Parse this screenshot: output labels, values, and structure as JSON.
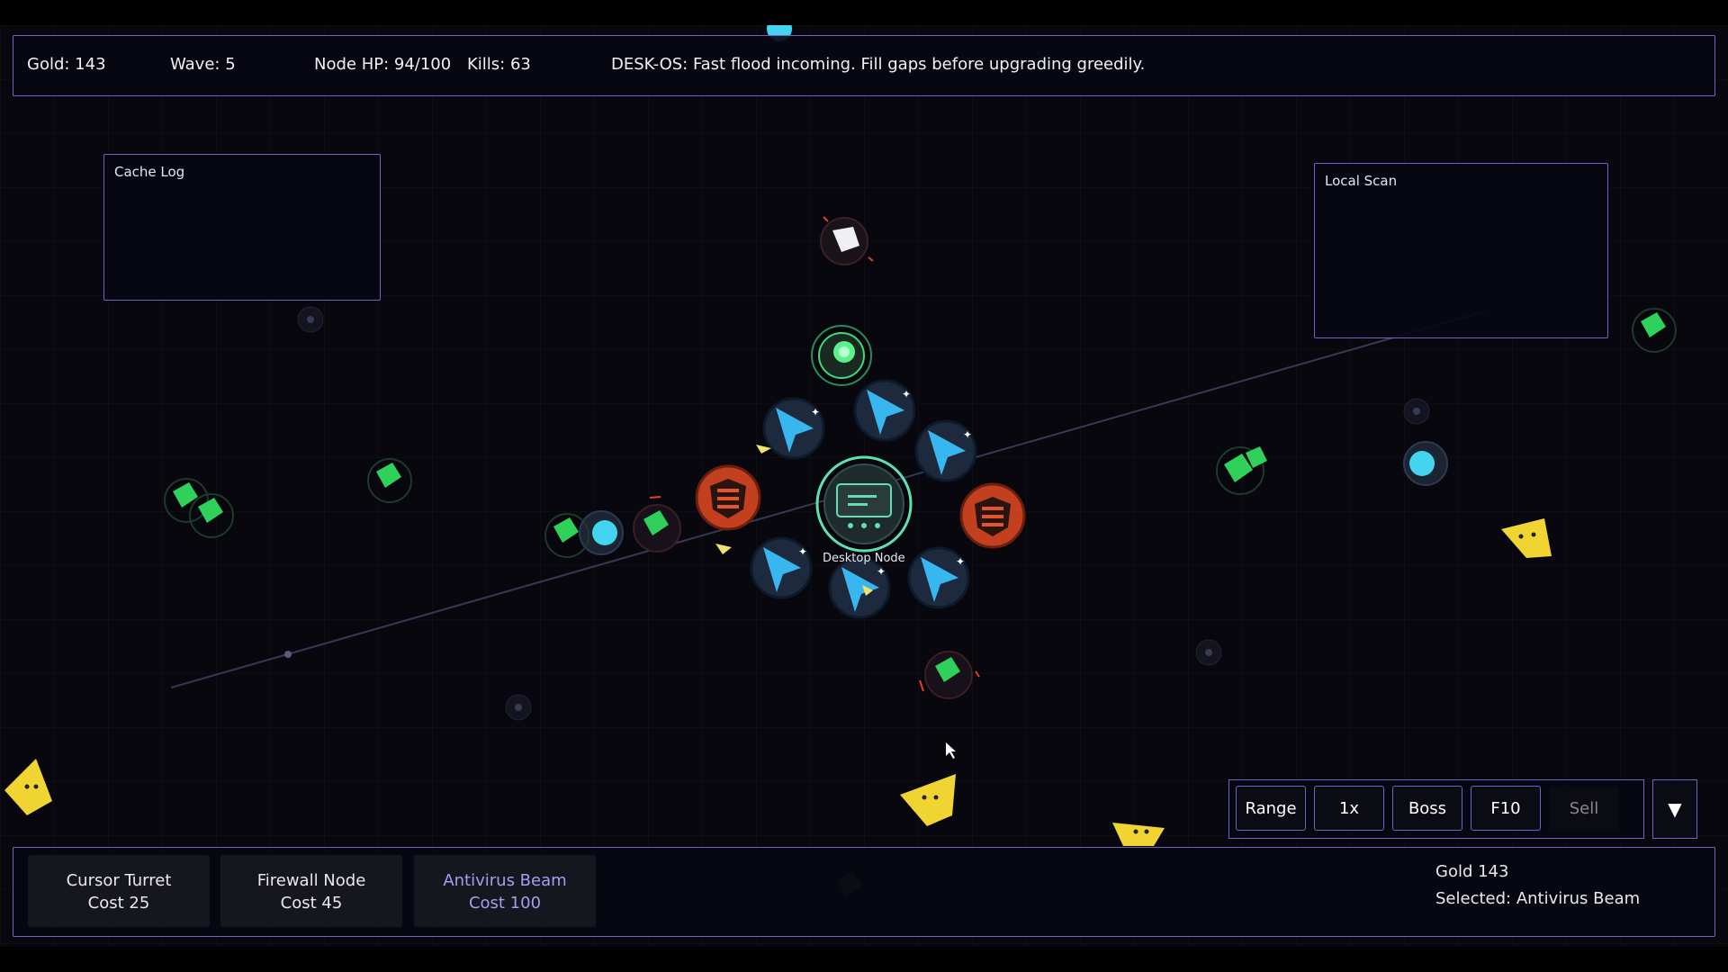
{
  "hud": {
    "gold": "Gold: 143",
    "wave": "Wave: 5",
    "node_hp": "Node HP: 94/100",
    "kills": "Kills: 63",
    "message": "DESK-OS: Fast flood incoming. Fill gaps before upgrading greedily."
  },
  "panels": {
    "cache_log": "Cache Log",
    "local_scan": "Local Scan"
  },
  "core": {
    "label": "Desktop Node"
  },
  "shop": [
    {
      "name": "Cursor Turret",
      "cost": "Cost 25"
    },
    {
      "name": "Firewall Node",
      "cost": "Cost 45"
    },
    {
      "name": "Antivirus Beam",
      "cost": "Cost 100"
    }
  ],
  "status": {
    "gold": "Gold 143",
    "selected": "Selected: Antivirus Beam"
  },
  "controls": {
    "range": "Range",
    "speed": "1x",
    "boss": "Boss",
    "f10": "F10",
    "sell": "Sell",
    "drop": "▼"
  },
  "colors": {
    "accent": "#6e64c8",
    "turret": "#38b6f0",
    "firewall": "#e3552c",
    "core": "#5fe0b0",
    "virus_green": "#2fd15a",
    "virus_yellow": "#f0d431",
    "selected_text": "#a89cf0"
  }
}
